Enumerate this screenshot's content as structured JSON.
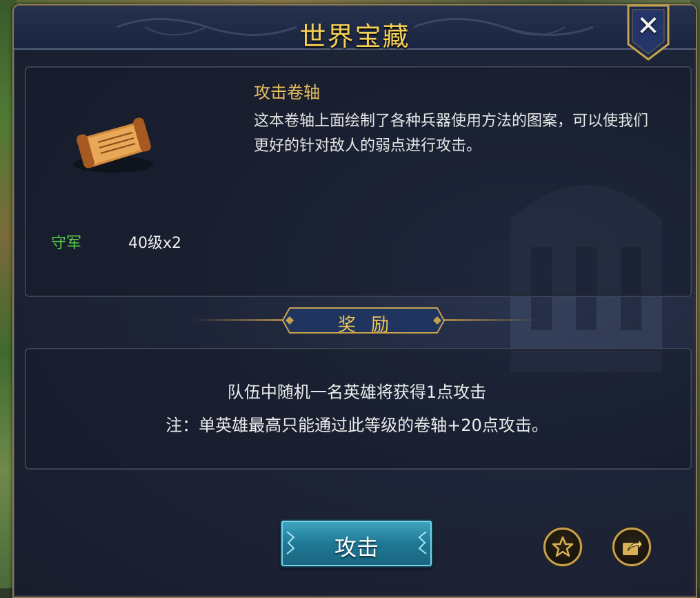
{
  "window": {
    "title": "世界宝藏",
    "close_icon": "close-icon"
  },
  "item": {
    "name": "攻击卷轴",
    "description": "这本卷轴上面绘制了各种兵器使用方法的图案，可以使我们更好的针对敌人的弱点进行攻击。",
    "image_icon": "scroll-icon"
  },
  "guard": {
    "label": "守军",
    "value": "40级x2"
  },
  "reward": {
    "header": "奖励",
    "line1": "队伍中随机一名英雄将获得1点攻击",
    "line2": "注：单英雄最高只能通过此等级的卷轴+20点攻击。"
  },
  "actions": {
    "attack_label": "攻击",
    "favorite_icon": "star-icon",
    "share_icon": "share-icon"
  },
  "colors": {
    "title": "#f4cf55",
    "item_name": "#e9bf61",
    "guard_label": "#58cf4a",
    "button": "#1f7894",
    "frame_gold": "#c7a24d"
  }
}
